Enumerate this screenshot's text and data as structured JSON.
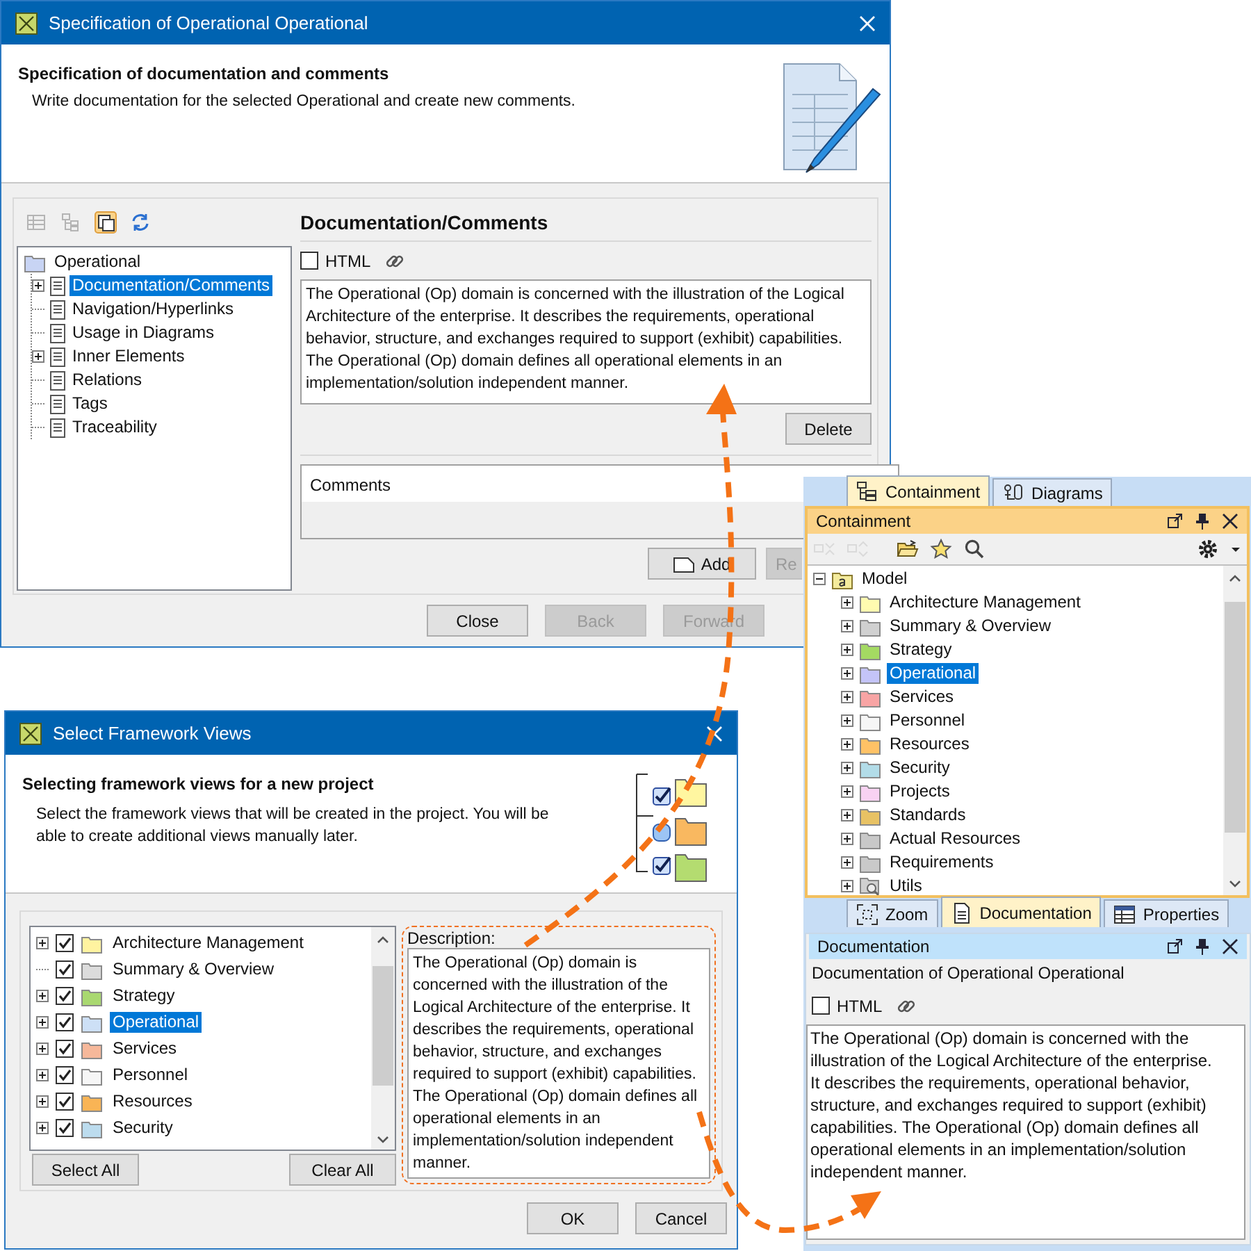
{
  "specification_window": {
    "title": "Specification of Operational Operational",
    "heading": "Specification of documentation and comments",
    "description": "Write documentation for the selected Operational and create new comments.",
    "toolbar": [
      {
        "kind": "grid",
        "disabled": true,
        "pressed": false
      },
      {
        "kind": "tree",
        "disabled": true,
        "pressed": false
      },
      {
        "kind": "pages",
        "disabled": false,
        "pressed": true
      },
      {
        "kind": "refresh",
        "disabled": false,
        "pressed": false
      }
    ],
    "tree": {
      "label": "Operational",
      "selected": false,
      "children": [
        {
          "label": "Documentation/Comments",
          "expandable": true,
          "selected": true
        },
        {
          "label": "Navigation/Hyperlinks",
          "expandable": false,
          "selected": false
        },
        {
          "label": "Usage in Diagrams",
          "expandable": false,
          "selected": false
        },
        {
          "label": "Inner Elements",
          "expandable": true,
          "selected": false
        },
        {
          "label": "Relations",
          "expandable": false,
          "selected": false
        },
        {
          "label": "Tags",
          "expandable": false,
          "selected": false
        },
        {
          "label": "Traceability",
          "expandable": false,
          "selected": false
        }
      ]
    },
    "panel_title": "Documentation/Comments",
    "html_checkbox": {
      "label": "HTML",
      "checked": false
    },
    "documentation": "The Operational (Op) domain is concerned with the illustration of the Logical Architecture of the enterprise. It describes the requirements, operational behavior, structure, and exchanges required to support (exhibit) capabilities. The Operational (Op) domain defines all operational elements in an implementation/solution independent manner.",
    "delete_button": {
      "label": "Delete",
      "disabled": false
    },
    "comments_header": "Comments",
    "comment_buttons": [
      {
        "label": "Add",
        "disabled": false
      },
      {
        "label": "Re",
        "disabled": true
      }
    ],
    "buttons": [
      {
        "label": "Close",
        "disabled": false
      },
      {
        "label": "Back",
        "disabled": true
      },
      {
        "label": "Forward",
        "disabled": true
      }
    ]
  },
  "framework_window": {
    "title": "Select Framework Views",
    "heading": "Selecting framework views for a new project",
    "description": "Select the framework views that will be created in the project. You will be able to create additional views manually later.",
    "views": [
      {
        "label": "Architecture Management",
        "expandable": true,
        "checked": true,
        "selected": false,
        "color": "#fff3a0"
      },
      {
        "label": "Summary & Overview",
        "expandable": false,
        "checked": true,
        "selected": false,
        "color": "#dcdcdc"
      },
      {
        "label": "Strategy",
        "expandable": true,
        "checked": true,
        "selected": false,
        "color": "#a9d870"
      },
      {
        "label": "Operational",
        "expandable": true,
        "checked": true,
        "selected": true,
        "color": "#cde0f6"
      },
      {
        "label": "Services",
        "expandable": true,
        "checked": true,
        "selected": false,
        "color": "#f6b89a"
      },
      {
        "label": "Personnel",
        "expandable": true,
        "checked": true,
        "selected": false,
        "color": "#f6f6f6"
      },
      {
        "label": "Resources",
        "expandable": true,
        "checked": true,
        "selected": false,
        "color": "#f9b455"
      },
      {
        "label": "Security",
        "expandable": true,
        "checked": true,
        "selected": false,
        "color": "#bcdcee"
      }
    ],
    "list_buttons": [
      "Select All",
      "Clear All"
    ],
    "description_label": "Description:",
    "description_text": "The Operational (Op) domain is concerned with the illustration of the Logical Architecture of the enterprise. It describes the requirements, operational behavior, structure, and exchanges required to support (exhibit) capabilities. The Operational (Op) domain defines all operational elements in an implementation/solution independent manner.",
    "buttons": [
      "OK",
      "Cancel"
    ]
  },
  "containment_panel": {
    "tabs": [
      {
        "label": "Containment",
        "kind": "tree",
        "selected": true
      },
      {
        "label": "Diagrams",
        "kind": "diagram",
        "selected": false
      }
    ],
    "title": "Containment",
    "toolbar": [
      {
        "kind": "collapse",
        "disabled": true
      },
      {
        "kind": "expand",
        "disabled": true
      },
      {
        "kind": "open-folder",
        "disabled": false
      },
      {
        "kind": "star",
        "disabled": false
      },
      {
        "kind": "search",
        "disabled": false
      }
    ],
    "tree": {
      "label": "Model",
      "expanded": true,
      "selected": false,
      "children": [
        {
          "label": "Architecture Management",
          "kind": "folder",
          "color": "#fffbb0",
          "selected": false
        },
        {
          "label": "Summary & Overview",
          "kind": "folder",
          "color": "#d0d0d0",
          "selected": false
        },
        {
          "label": "Strategy",
          "kind": "folder",
          "color": "#a4da62",
          "selected": false
        },
        {
          "label": "Operational",
          "kind": "folder",
          "color": "#c4c4f8",
          "selected": true
        },
        {
          "label": "Services",
          "kind": "folder",
          "color": "#f8a4a4",
          "selected": false
        },
        {
          "label": "Personnel",
          "kind": "folder",
          "color": "#f6f6f6",
          "selected": false
        },
        {
          "label": "Resources",
          "kind": "folder",
          "color": "#ffc266",
          "selected": false
        },
        {
          "label": "Security",
          "kind": "folder",
          "color": "#b2dce8",
          "selected": false
        },
        {
          "label": "Projects",
          "kind": "folder",
          "color": "#f8d2f2",
          "selected": false
        },
        {
          "label": "Standards",
          "kind": "folder",
          "color": "#e8c264",
          "selected": false
        },
        {
          "label": "Actual Resources",
          "kind": "folder",
          "color": "#c8c8c8",
          "selected": false
        },
        {
          "label": "Requirements",
          "kind": "folder",
          "color": "#c9c9c9",
          "selected": false
        },
        {
          "label": "Utils",
          "kind": "utility",
          "selected": false
        }
      ]
    }
  },
  "documentation_panel": {
    "tabs": [
      {
        "label": "Zoom",
        "kind": "zoom",
        "selected": false
      },
      {
        "label": "Documentation",
        "kind": "page",
        "selected": true
      },
      {
        "label": "Properties",
        "kind": "table",
        "selected": false
      }
    ],
    "title": "Documentation",
    "subtitle": "Documentation of Operational Operational",
    "html_checkbox": {
      "label": "HTML",
      "checked": false
    },
    "text": "The Operational (Op) domain is concerned with the illustration of the Logical Architecture of the enterprise. It describes the requirements, operational behavior, structure, and exchanges required to support (exhibit) capabilities. The Operational (Op) domain defines all operational elements in an implementation/solution independent manner."
  }
}
